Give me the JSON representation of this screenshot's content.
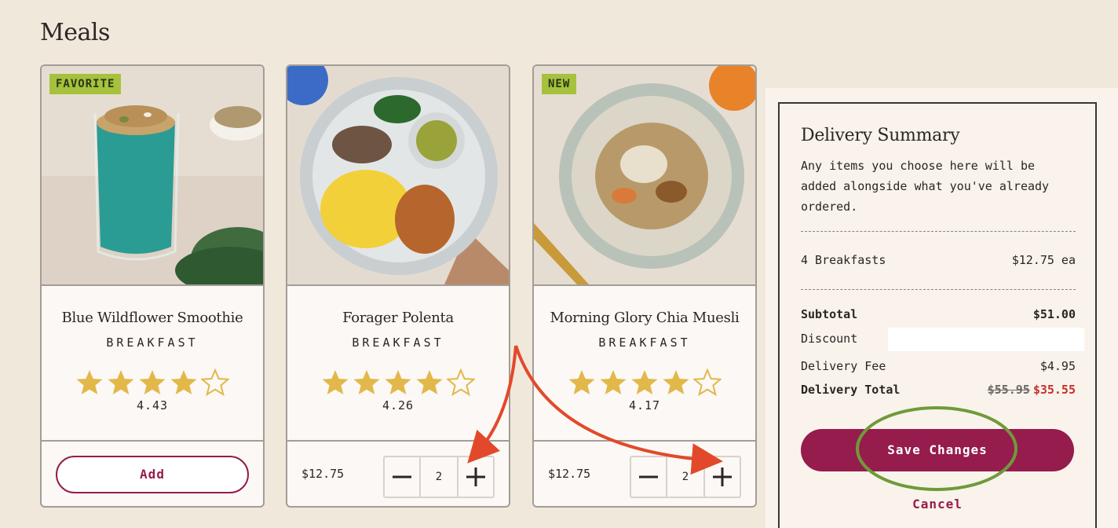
{
  "page": {
    "title": "Meals"
  },
  "meals": [
    {
      "badge": "FAVORITE",
      "name": "Blue Wildflower Smoothie",
      "category": "BREAKFAST",
      "rating": "4.43",
      "stars": 4.43,
      "action": {
        "add_label": "Add"
      }
    },
    {
      "badge": "",
      "name": "Forager Polenta",
      "category": "BREAKFAST",
      "rating": "4.26",
      "stars": 4.26,
      "price": "$12.75",
      "quantity": "2"
    },
    {
      "badge": "NEW",
      "name": "Morning Glory Chia Muesli",
      "category": "BREAKFAST",
      "rating": "4.17",
      "stars": 4.17,
      "price": "$12.75",
      "quantity": "2"
    }
  ],
  "summary": {
    "title": "Delivery Summary",
    "description": "Any items you choose here will be added alongside what you've already ordered.",
    "items_label": "4 Breakfasts",
    "items_price": "$12.75 ea",
    "subtotal_label": "Subtotal",
    "subtotal_value": "$51.00",
    "discount_label": "Discount",
    "discount_value": "",
    "delivery_fee_label": "Delivery Fee",
    "delivery_fee_value": "$4.95",
    "delivery_total_label": "Delivery Total",
    "delivery_total_old": "$55.95",
    "delivery_total_new": "$35.55",
    "save_label": "Save Changes",
    "cancel_label": "Cancel"
  },
  "colors": {
    "background": "#f1e8dc",
    "brand": "#951c4c",
    "badge": "#a6c23d",
    "star": "#e2b84a",
    "sale_price": "#c5302b",
    "annotation_arrow": "#e2492a",
    "annotation_circle": "#6f9a3a"
  },
  "icons": {
    "star": "star-icon",
    "star_outline": "star-outline-icon",
    "minus": "minus-icon",
    "plus": "plus-icon"
  }
}
